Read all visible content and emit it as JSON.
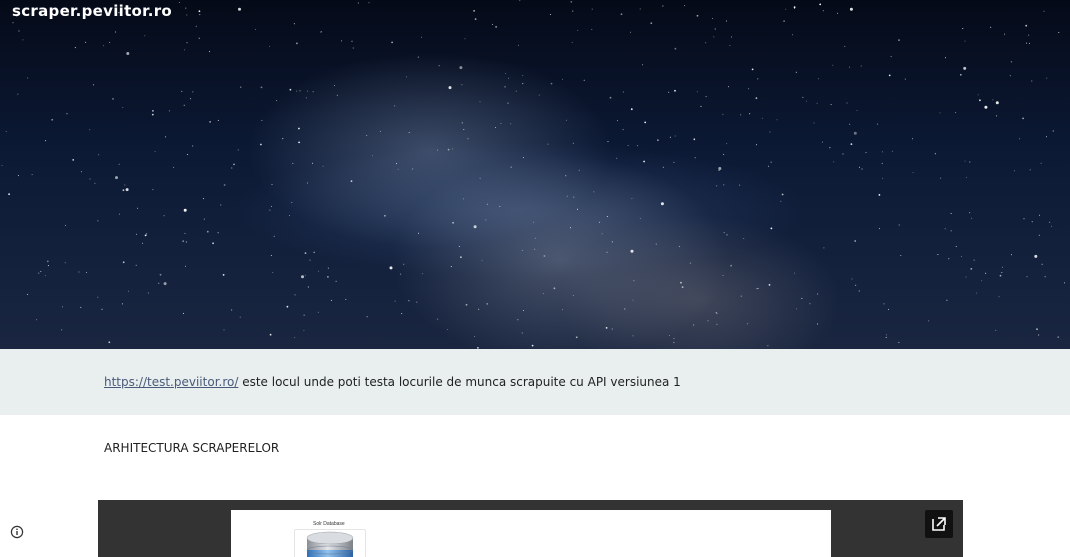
{
  "header": {
    "site_title": "scraper.peviitor.ro"
  },
  "info": {
    "link_text": "https://test.peviitor.ro/",
    "text": "este locul unde poti testa locurile de munca scrapuite cu API versiunea 1"
  },
  "section": {
    "heading": "ARHITECTURA SCRAPERELOR"
  },
  "embed": {
    "diagram_label": "Solr Database",
    "popout_icon": "open-in-new-icon"
  },
  "footer": {
    "info_icon": "info-icon"
  },
  "colors": {
    "info_band_bg": "#e8efee",
    "link": "#4a5a7a",
    "embed_bg": "#333333"
  }
}
